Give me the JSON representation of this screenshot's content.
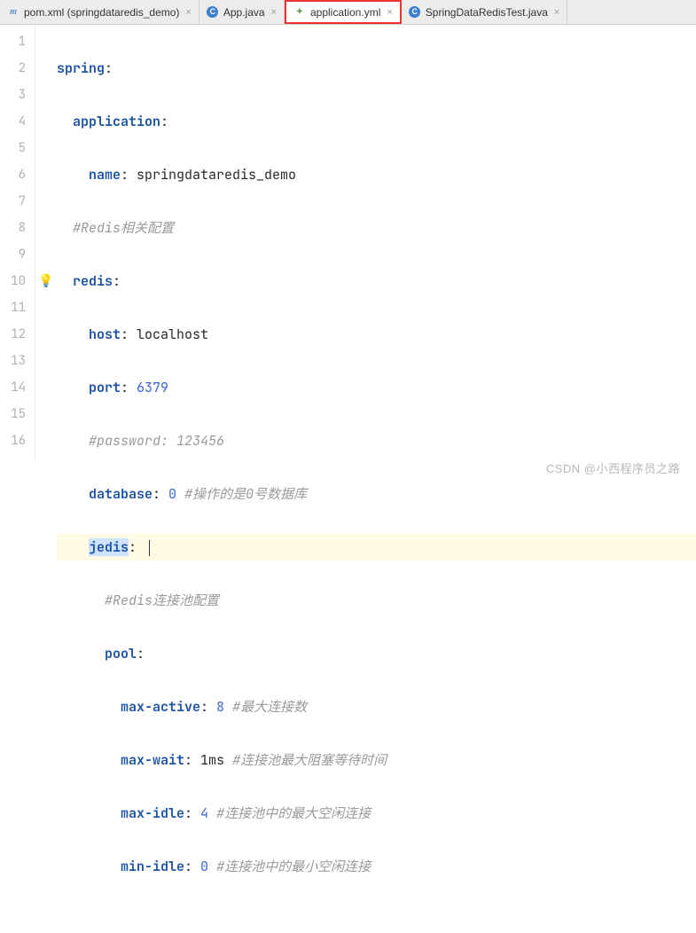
{
  "tabs": [
    {
      "icon": "m",
      "label": "pom.xml (springdataredis_demo)"
    },
    {
      "icon": "c",
      "label": "App.java"
    },
    {
      "icon": "y",
      "label": "application.yml",
      "highlighted": true
    },
    {
      "icon": "c",
      "label": "SpringDataRedisTest.java"
    }
  ],
  "code": {
    "l1": {
      "key": "spring",
      "colon": ":"
    },
    "l2": {
      "key": "application",
      "colon": ":"
    },
    "l3": {
      "key": "name",
      "colon": ": ",
      "val": "springdataredis_demo"
    },
    "l4": {
      "cm": "#Redis相关配置"
    },
    "l5": {
      "key": "redis",
      "colon": ":"
    },
    "l6": {
      "key": "host",
      "colon": ": ",
      "val": "localhost"
    },
    "l7": {
      "key": "port",
      "colon": ": ",
      "val": "6379"
    },
    "l8": {
      "cm": "#password: 123456"
    },
    "l9": {
      "key": "database",
      "colon": ": ",
      "val": "0",
      "cm": " #操作的是0号数据库"
    },
    "l10": {
      "key": "jedis",
      "colon": ":"
    },
    "l11": {
      "cm": "#Redis连接池配置"
    },
    "l12": {
      "key": "pool",
      "colon": ":"
    },
    "l13": {
      "key": "max-active",
      "colon": ": ",
      "val": "8",
      "cm": " #最大连接数"
    },
    "l14": {
      "key": "max-wait",
      "colon": ": ",
      "val": "1ms",
      "cm": " #连接池最大阻塞等待时间"
    },
    "l15": {
      "key": "max-idle",
      "colon": ": ",
      "val": "4",
      "cm": " #连接池中的最大空闲连接"
    },
    "l16": {
      "key": "min-idle",
      "colon": ": ",
      "val": "0",
      "cm": " #连接池中的最小空闲连接"
    }
  },
  "line_numbers": [
    "1",
    "2",
    "3",
    "4",
    "5",
    "6",
    "7",
    "8",
    "9",
    "10",
    "11",
    "12",
    "13",
    "14",
    "15",
    "16"
  ],
  "watermark": "CSDN @小西程序员之路"
}
